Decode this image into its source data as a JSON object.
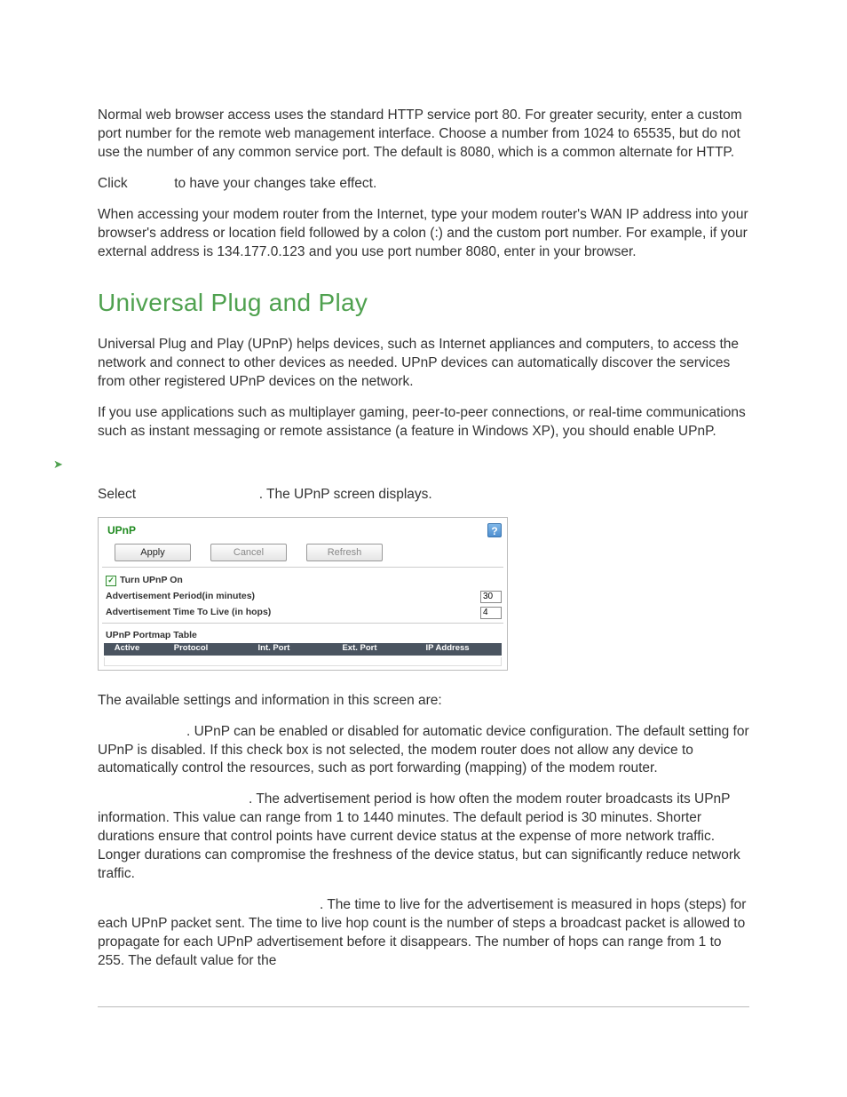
{
  "intro": {
    "p1": "Normal web browser access uses the standard HTTP service port 80. For greater security, enter a custom port number for the remote web management interface. Choose a number from 1024 to 65535, but do not use the number of any common service port. The default is 8080, which is a common alternate for HTTP.",
    "p2_a": "Click ",
    "p2_b": " to have your changes take effect.",
    "p3": "When accessing your modem router from the Internet, type your modem router's WAN IP address into your browser's address or location field followed by a colon (:) and the custom port number. For example, if your external address is 134.177.0.123 and you use port number 8080, enter                                                       in your browser."
  },
  "section_title": "Universal Plug and Play",
  "upnp_intro_1": "Universal Plug and Play (UPnP) helps devices, such as Internet appliances and computers, to access the network and connect to other devices as needed. UPnP devices can automatically discover the services from other registered UPnP devices on the network.",
  "upnp_intro_2": "If you use applications such as multiplayer gaming, peer-to-peer connections, or real-time communications such as instant messaging or remote assistance (a feature in Windows XP), you should enable UPnP.",
  "bullet_arrow": "➤",
  "bullet_text": "",
  "step_a": "Select ",
  "step_b": ". The UPnP screen displays.",
  "panel": {
    "title": "UPnP",
    "help": "?",
    "btn_apply": "Apply",
    "btn_cancel": "Cancel",
    "btn_refresh": "Refresh",
    "chk_mark": "✓",
    "turn_on": "Turn UPnP On",
    "adv_period_lbl": "Advertisement Period(in minutes)",
    "adv_period_val": "30",
    "adv_ttl_lbl": "Advertisement Time To Live (in hops)",
    "adv_ttl_val": "4",
    "portmap_title": "UPnP Portmap Table",
    "hdr_active": "Active",
    "hdr_protocol": "Protocol",
    "hdr_intport": "Int. Port",
    "hdr_extport": "Ext. Port",
    "hdr_ip": "IP Address"
  },
  "available_line": "The available settings and information in this screen are:",
  "desc1": ". UPnP can be enabled or disabled for automatic device configuration. The default setting for UPnP is disabled. If this check box is not selected, the modem router does not allow any device to automatically control the resources, such as port forwarding (mapping) of the modem router.",
  "desc2": ". The advertisement period is how often the modem router broadcasts its UPnP information. This value can range from 1 to 1440 minutes. The default period is 30 minutes. Shorter durations ensure that control points have current device status at the expense of more network traffic. Longer durations can compromise the freshness of the device status, but can significantly reduce network traffic.",
  "desc3": ". The time to live for the advertisement is measured in hops (steps) for each UPnP packet sent. The time to live hop count is the number of steps a broadcast packet is allowed to propagate for each UPnP advertisement before it disappears. The number of hops can range from 1 to 255. The default value for the"
}
